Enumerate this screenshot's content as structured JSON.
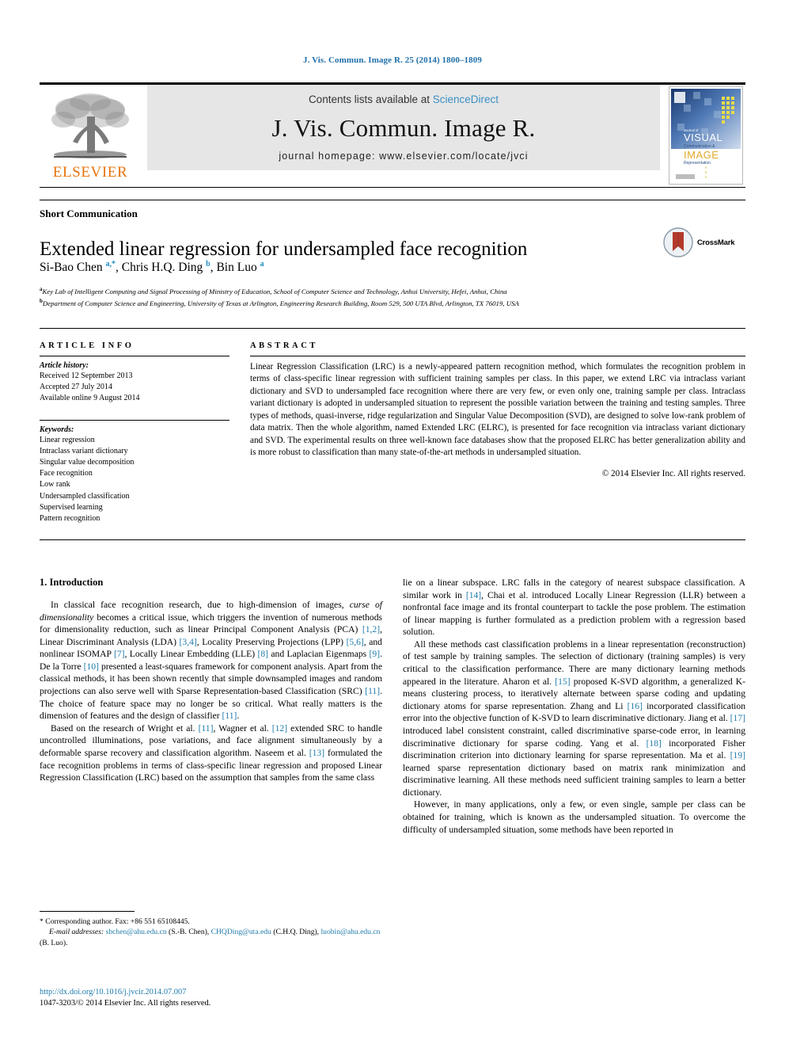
{
  "running_head": "J. Vis. Commun. Image R. 25 (2014) 1800–1809",
  "masthead": {
    "publisher": "ELSEVIER",
    "contents_prefix": "Contents lists available at ",
    "contents_link": "ScienceDirect",
    "journal_title": "J. Vis. Commun. Image R.",
    "homepage": "journal homepage: www.elsevier.com/locate/jvci",
    "cover_title_line1": "VISUAL",
    "cover_title_line2": "Communication &",
    "cover_title_line3": "IMAGE",
    "cover_title_line4": "Representation",
    "cover_kicker": "Journal of"
  },
  "article": {
    "section_type": "Short Communication",
    "title": "Extended linear regression for undersampled face recognition",
    "crossmark_label": "CrossMark",
    "authors_html": "Si-Bao Chen <sup>a,*</sup>, Chris H.Q. Ding <sup>b</sup>, Bin Luo <sup>a</sup>",
    "affiliations": [
      {
        "marker": "a",
        "text": "Key Lab of Intelligent Computing and Signal Processing of Ministry of Education, School of Computer Science and Technology, Anhui University, Hefei, Anhui, China"
      },
      {
        "marker": "b",
        "text": "Department of Computer Science and Engineering, University of Texas at Arlington, Engineering Research Building, Room 529, 500 UTA Blvd, Arlington, TX 76019, USA"
      }
    ]
  },
  "article_info": {
    "heading": "ARTICLE INFO",
    "history_label": "Article history:",
    "history": [
      "Received 12 September 2013",
      "Accepted 27 July 2014",
      "Available online 9 August 2014"
    ],
    "keywords_label": "Keywords:",
    "keywords": [
      "Linear regression",
      "Intraclass variant dictionary",
      "Singular value decomposition",
      "Face recognition",
      "Low rank",
      "Undersampled classification",
      "Supervised learning",
      "Pattern recognition"
    ]
  },
  "abstract": {
    "heading": "ABSTRACT",
    "text": "Linear Regression Classification (LRC) is a newly-appeared pattern recognition method, which formulates the recognition problem in terms of class-specific linear regression with sufficient training samples per class. In this paper, we extend LRC via intraclass variant dictionary and SVD to undersampled face recognition where there are very few, or even only one, training sample per class. Intraclass variant dictionary is adopted in undersampled situation to represent the possible variation between the training and testing samples. Three types of methods, quasi-inverse, ridge regularization and Singular Value Decomposition (SVD), are designed to solve low-rank problem of data matrix. Then the whole algorithm, named Extended LRC (ELRC), is presented for face recognition via intraclass variant dictionary and SVD. The experimental results on three well-known face databases show that the proposed ELRC has better generalization ability and is more robust to classification than many state-of-the-art methods in undersampled situation.",
    "copyright": "© 2014 Elsevier Inc. All rights reserved."
  },
  "body": {
    "section_heading": "1. Introduction",
    "left_paragraphs": [
      "In classical face recognition research, due to high-dimension of images, <i>curse of dimensionality</i> becomes a critical issue, which triggers the invention of numerous methods for dimensionality reduction, such as linear Principal Component Analysis (PCA) <a class=\"ref\">[1,2]</a>, Linear Discriminant Analysis (LDA) <a class=\"ref\">[3,4]</a>, Locality Preserving Projections (LPP) <a class=\"ref\">[5,6]</a>, and nonlinear ISOMAP <a class=\"ref\">[7]</a>, Locally Linear Embedding (LLE) <a class=\"ref\">[8]</a> and Laplacian Eigenmaps <a class=\"ref\">[9]</a>. De la Torre <a class=\"ref\">[10]</a> presented a least-squares framework for component analysis. Apart from the classical methods, it has been shown recently that simple downsampled images and random projections can also serve well with Sparse Representation-based Classification (SRC) <a class=\"ref\">[11]</a>. The choice of feature space may no longer be so critical. What really matters is the dimension of features and the design of classifier <a class=\"ref\">[11]</a>.",
      "Based on the research of Wright et al. <a class=\"ref\">[11]</a>, Wagner et al. <a class=\"ref\">[12]</a> extended SRC to handle uncontrolled illuminations, pose variations, and face alignment simultaneously by a deformable sparse recovery and classification algorithm. Naseem et al. <a class=\"ref\">[13]</a> formulated the face recognition problems in terms of class-specific linear regression and proposed Linear Regression Classification (LRC) based on the assumption that samples from the same class"
    ],
    "right_paragraphs": [
      "lie on a linear subspace. LRC falls in the category of nearest subspace classification. A similar work in <a class=\"ref\">[14]</a>, Chai et al. introduced Locally Linear Regression (LLR) between a nonfrontal face image and its frontal counterpart to tackle the pose problem. The estimation of linear mapping is further formulated as a prediction problem with a regression based solution.",
      "All these methods cast classification problems in a linear representation (reconstruction) of test sample by training samples. The selection of dictionary (training samples) is very critical to the classification performance. There are many dictionary learning methods appeared in the literature. Aharon et al. <a class=\"ref\">[15]</a> proposed K-SVD algorithm, a generalized K-means clustering process, to iteratively alternate between sparse coding and updating dictionary atoms for sparse representation. Zhang and Li <a class=\"ref\">[16]</a> incorporated classification error into the objective function of K-SVD to learn discriminative dictionary. Jiang et al. <a class=\"ref\">[17]</a> introduced label consistent constraint, called discriminative sparse-code error, in learning discriminative dictionary for sparse coding. Yang et al. <a class=\"ref\">[18]</a> incorporated Fisher discrimination criterion into dictionary learning for sparse representation. Ma et al. <a class=\"ref\">[19]</a> learned sparse representation dictionary based on matrix rank minimization and discriminative learning. All these methods need sufficient training samples to learn a better dictionary.",
      "However, in many applications, only a few, or even single, sample per class can be obtained for training, which is known as the undersampled situation. To overcome the difficulty of undersampled situation, some methods have been reported in"
    ]
  },
  "footnote": {
    "corresponding": "* Corresponding author. Fax: +86 551 65108445.",
    "email_label": "E-mail addresses:",
    "emails_html": " <span class=\"link\">sbchen@ahu.edu.cn</span> (S.-B. Chen), <span class=\"link\">CHQDing@uta.edu</span> (C.H.Q. Ding), <span class=\"link\">luobin@ahu.edu.cn</span> (B. Luo)."
  },
  "footer": {
    "doi": "http://dx.doi.org/10.1016/j.jvcir.2014.07.007",
    "issn_copyright": "1047-3203/© 2014 Elsevier Inc. All rights reserved."
  },
  "colors": {
    "link": "#1f7bab",
    "running_head": "#1f6fa8",
    "elsevier_orange": "#E8730C",
    "masthead_gray": "#e6e6e6",
    "crossmark_red": "#b33a2b"
  }
}
